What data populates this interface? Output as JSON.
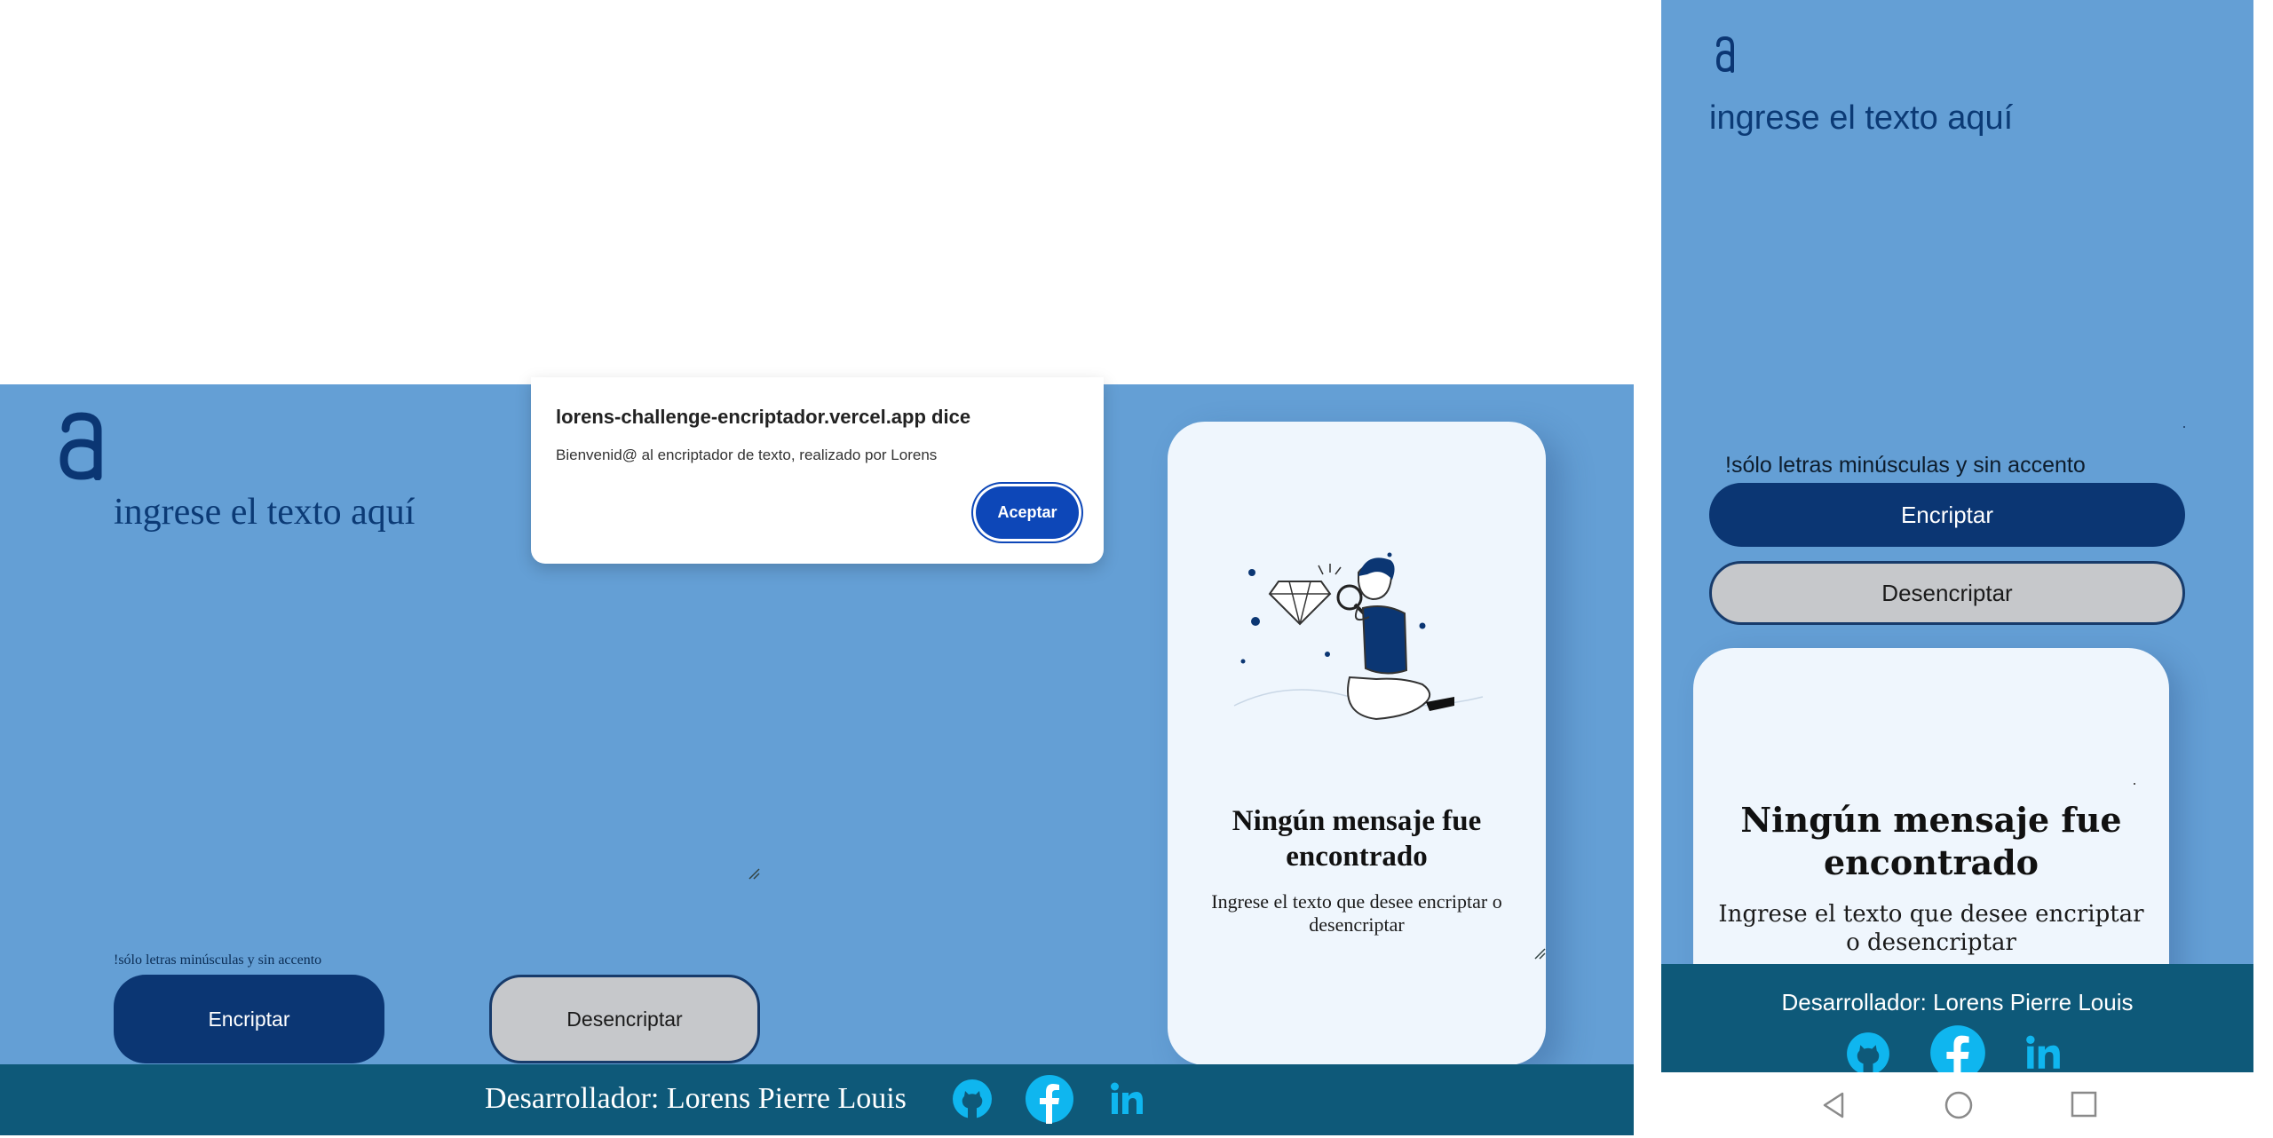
{
  "dialog": {
    "title": "lorens-challenge-encriptador.vercel.app dice",
    "message": "Bienvenid@ al encriptador de texto, realizado por Lorens",
    "accept_label": "Aceptar"
  },
  "desktop": {
    "logo_icon": "letter-a-logo-icon",
    "textarea_placeholder": "ingrese el texto aquí",
    "hint": "!sólo letras minúsculas y sin accento",
    "encrypt_label": "Encriptar",
    "decrypt_label": "Desencriptar",
    "output": {
      "title": "Ningún mensaje fue encontrado",
      "subtitle": "Ingrese el texto que desee encriptar o desencriptar",
      "illustration": "person-inspecting-diamond-illustration"
    },
    "footer": {
      "developer": "Desarrollador: Lorens Pierre Louis",
      "icons": [
        "github-icon",
        "facebook-icon",
        "linkedin-icon"
      ]
    }
  },
  "mobile": {
    "logo_icon": "letter-a-logo-icon",
    "textarea_placeholder": "ingrese el texto aquí",
    "hint": "!sólo letras minúsculas y sin accento",
    "encrypt_label": "Encriptar",
    "decrypt_label": "Desencriptar",
    "output": {
      "title": "Ningún mensaje fue encontrado",
      "subtitle": "Ingrese el texto que desee encriptar o desencriptar"
    },
    "footer": {
      "developer": "Desarrollador: Lorens Pierre Louis",
      "icons": [
        "github-icon",
        "facebook-icon",
        "linkedin-icon"
      ]
    },
    "navbar": [
      "nav-back-icon",
      "nav-home-icon",
      "nav-recent-apps-icon"
    ]
  },
  "colors": {
    "background": "#649fd5",
    "primary_button": "#0b3673",
    "secondary_button": "#c6c8cb",
    "footer": "#0e5979",
    "card": "#eff6fd",
    "dialog_button": "#0d47b8"
  }
}
